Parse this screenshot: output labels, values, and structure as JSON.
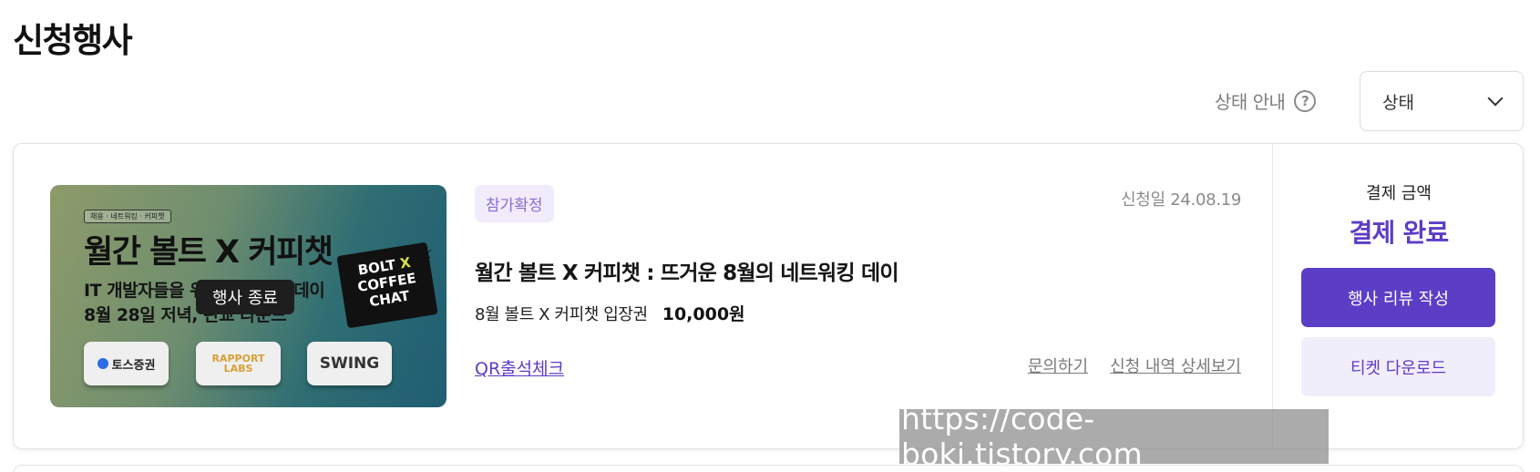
{
  "page": {
    "title": "신청행사"
  },
  "filter": {
    "status_guide_label": "상태 안내",
    "help_icon": "question-circle-icon",
    "status_select_value": "상태",
    "chevron_icon": "chevron-down-icon"
  },
  "event_card": {
    "thumbnail": {
      "tag": "채용 · 네트워킹 · 커피챗",
      "title": "월간 볼트 X 커피챗",
      "line1": "IT 개발자들을 위한 네트워킹 데이",
      "line2": "8월 28일 저녁, 판교 라운드",
      "ended_badge": "행사 종료",
      "chat_line1": "BOLT",
      "chat_x": "X",
      "chat_line2": "COFFEE",
      "chat_line3": "CHAT",
      "sponsor1": "토스증권",
      "sponsor2_line1": "RAPPORT",
      "sponsor2_line2": "LABS",
      "sponsor3": "SWING"
    },
    "status_chip": "참가확정",
    "apply_date": "신청일 24.08.19",
    "title": "월간 볼트 X 커피챗 : 뜨거운 8월의 네트워킹 데이",
    "ticket_name": "8월 볼트 X 커피챗 입장권",
    "ticket_price": "10,000원",
    "qr_link": "QR출석체크",
    "inquiry_link": "문의하기",
    "detail_link": "신청 내역 상세보기",
    "payment": {
      "label": "결제 금액",
      "status": "결제 완료",
      "review_button": "행사 리뷰 작성",
      "download_button": "티켓 다운로드"
    }
  },
  "watermark": "https://code-boki.tistory.com",
  "colors": {
    "accent": "#5b3dc6",
    "accent_light": "#f1eefb",
    "chip_text": "#8a6bd6"
  }
}
